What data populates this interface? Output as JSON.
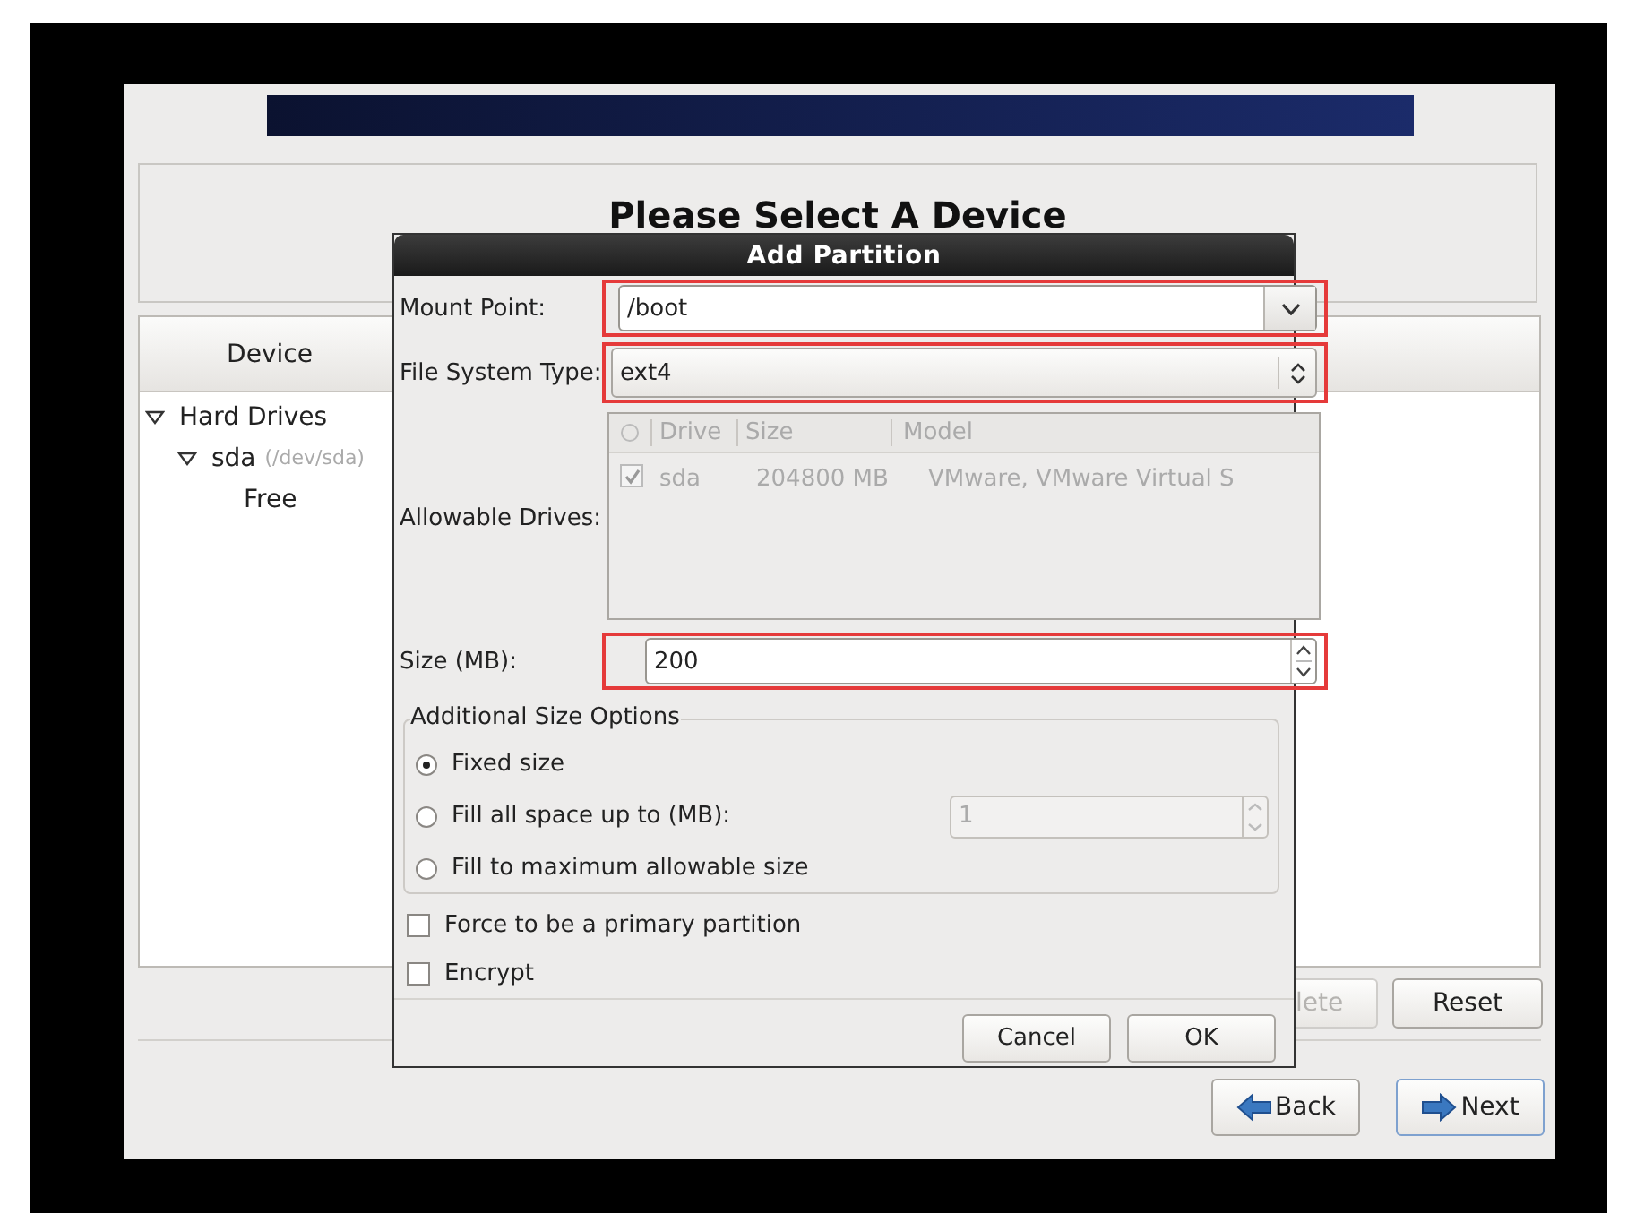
{
  "heading": "Please Select A Device",
  "device_table": {
    "columns": [
      "Device"
    ],
    "tree": [
      {
        "label": "Hard Drives",
        "expanded": true,
        "children": [
          {
            "label": "sda",
            "detail": "(/dev/sda)",
            "expanded": true,
            "children": [
              {
                "label": "Free"
              }
            ]
          }
        ]
      }
    ]
  },
  "device_buttons": [
    {
      "label": "lete",
      "disabled": true
    },
    {
      "label": "Reset",
      "disabled": false
    }
  ],
  "nav_buttons": [
    {
      "label": "Back",
      "kind": "back",
      "focused": false
    },
    {
      "label": "Next",
      "kind": "next",
      "focused": true
    }
  ],
  "dialog": {
    "title": "Add Partition",
    "mount_point": {
      "label": "Mount Point:",
      "value": "/boot",
      "highlighted": true
    },
    "file_system_type": {
      "label": "File System Type:",
      "value": "ext4",
      "highlighted": true
    },
    "allowable_drives": {
      "label": "Allowable Drives:",
      "disabled": true,
      "columns": [
        "Drive",
        "Size",
        "Model"
      ],
      "rows": [
        {
          "checked": true,
          "drive": "sda",
          "size": "204800 MB",
          "model": "VMware, VMware Virtual S"
        }
      ]
    },
    "size": {
      "label": "Size (MB):",
      "value": "200",
      "highlighted": true
    },
    "size_options": {
      "title": "Additional Size Options",
      "options": [
        {
          "label": "Fixed size",
          "selected": true
        },
        {
          "label": "Fill all space up to (MB):",
          "selected": false,
          "value": "1",
          "value_disabled": true
        },
        {
          "label": "Fill to maximum allowable size",
          "selected": false
        }
      ]
    },
    "checkboxes": [
      {
        "label": "Force to be a primary partition",
        "checked": false
      },
      {
        "label": "Encrypt",
        "checked": false
      }
    ],
    "buttons": [
      "Cancel",
      "OK"
    ]
  }
}
